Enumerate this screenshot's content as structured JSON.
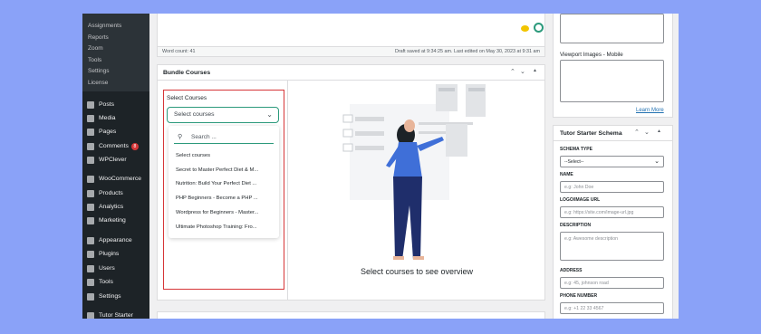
{
  "sidebar": {
    "submenu": [
      "Assignments",
      "Reports",
      "Zoom",
      "Tools",
      "Settings",
      "License"
    ],
    "items": [
      {
        "label": "Posts",
        "icon": "pin-icon"
      },
      {
        "label": "Media",
        "icon": "media-icon"
      },
      {
        "label": "Pages",
        "icon": "pages-icon"
      },
      {
        "label": "Comments",
        "icon": "comments-icon",
        "badge": "8"
      },
      {
        "label": "WPClever",
        "icon": "wpclever-icon"
      },
      {
        "label": "WooCommerce",
        "icon": "woocommerce-icon"
      },
      {
        "label": "Products",
        "icon": "products-icon"
      },
      {
        "label": "Analytics",
        "icon": "analytics-icon"
      },
      {
        "label": "Marketing",
        "icon": "marketing-icon"
      },
      {
        "label": "Appearance",
        "icon": "appearance-icon"
      },
      {
        "label": "Plugins",
        "icon": "plugins-icon"
      },
      {
        "label": "Users",
        "icon": "users-icon"
      },
      {
        "label": "Tools",
        "icon": "tools-icon"
      },
      {
        "label": "Settings",
        "icon": "settings-icon"
      },
      {
        "label": "Tutor Starter",
        "icon": "tutor-icon"
      }
    ]
  },
  "editor": {
    "word_count": "Word count: 41",
    "draft_status": "Draft saved at 9:34:25 am. Last edited on May 30, 2023 at 9:31 am"
  },
  "bundle": {
    "title": "Bundle Courses",
    "select_label": "Select Courses",
    "select_value": "Select courses",
    "search_placeholder": "Search ...",
    "options": [
      "Select courses",
      "Secret to Master Perfect Diet & M...",
      "Nutrition: Build Your Perfect Diet ...",
      "PHP Beginners - Become a PHP ...",
      "Wordpress for Beginners - Master...",
      "Ultimate Photoshop Training: Fro..."
    ],
    "overview_text": "Select courses to see overview"
  },
  "right": {
    "viewport_label": "Viewport Images - Mobile",
    "learn_more": "Learn More",
    "schema_title": "Tutor Starter Schema",
    "schema_type_label": "SCHEMA TYPE",
    "schema_type_value": "--Select--",
    "name_label": "NAME",
    "name_placeholder": "e.g: John Doe",
    "logo_label": "LOGO/IMAGE URL",
    "logo_placeholder": "e.g: https://site.com/image-url.jpg",
    "description_label": "DESCRIPTION",
    "description_placeholder": "e.g: Awesome description",
    "address_label": "ADDRESS",
    "address_placeholder": "e.g: 45, johnson road",
    "phone_label": "PHONE NUMBER",
    "phone_placeholder": "e.g: +1 22 33 4567"
  },
  "colors": {
    "accent": "#2c9a7c",
    "highlight": "#d63638",
    "sidebar": "#1d2327",
    "background": "#8aa2f8"
  }
}
